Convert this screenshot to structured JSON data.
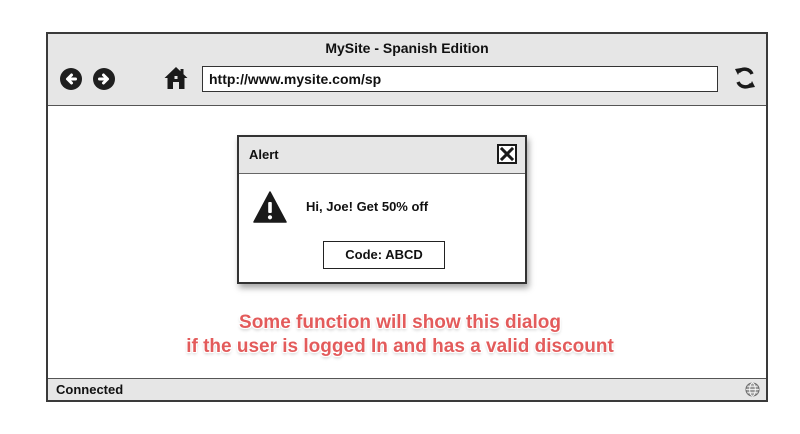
{
  "browser": {
    "title": "MySite - Spanish Edition",
    "url": "http://www.mysite.com/sp",
    "status": "Connected",
    "icons": {
      "back": "arrow-left-circle-icon",
      "forward": "arrow-right-circle-icon",
      "home": "home-icon",
      "refresh": "refresh-icon",
      "status": "globe-icon"
    }
  },
  "dialog": {
    "title": "Alert",
    "message": "Hi, Joe! Get 50% off",
    "code_label": "Code: ABCD",
    "icons": {
      "close": "close-icon",
      "warning": "warning-icon"
    }
  },
  "annotation": {
    "line1": "Some function will show this dialog",
    "line2": "if the user is logged In and has a valid discount",
    "color": "#e35b5b"
  }
}
